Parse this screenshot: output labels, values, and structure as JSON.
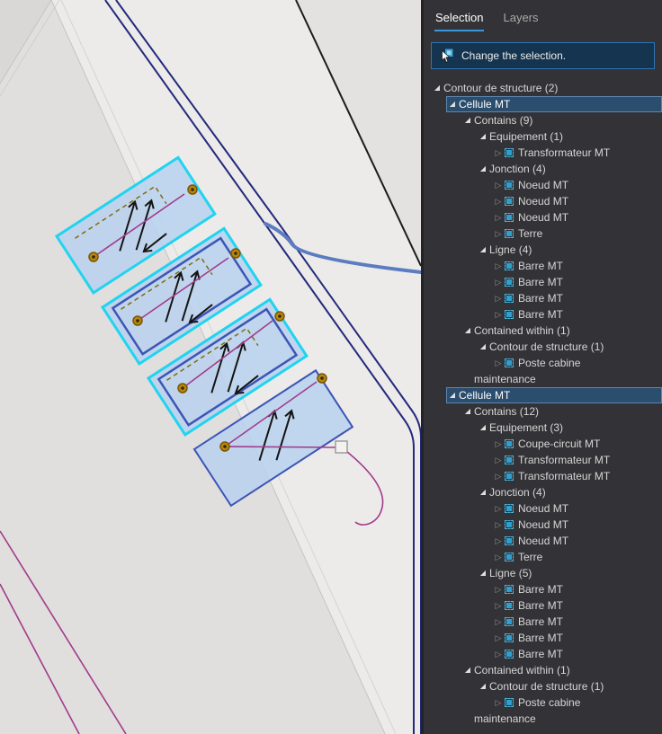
{
  "colors": {
    "accent_blue": "#3a96dd",
    "selection_cyan": "#22d3f0",
    "cell_fill": "#b9d2ee",
    "cell_border": "#3d55b5",
    "node_orange": "#b8860b",
    "line_magenta": "#a23a8c",
    "line_navy": "#232a7c",
    "line_steel": "#5b7cc0",
    "dashed_olive": "#7d6d10",
    "panel_bg": "#333337",
    "selected_row_bg": "#2b4d6e",
    "action_bar_bg": "#14344f",
    "action_bar_border": "#2e75b5"
  },
  "panel": {
    "tabs": [
      {
        "label": "Selection",
        "active": true
      },
      {
        "label": "Layers",
        "active": false
      }
    ],
    "action_bar": {
      "label": "Change the selection."
    },
    "tree": [
      {
        "label": "Contour de structure (2)",
        "level": 0,
        "glyph": "expanded"
      },
      {
        "label": "Cellule MT",
        "level": 1,
        "glyph": "expanded",
        "selected": true
      },
      {
        "label": "Contains (9)",
        "level": 2,
        "glyph": "expanded"
      },
      {
        "label": "Equipement (1)",
        "level": 3,
        "glyph": "expanded"
      },
      {
        "label": "Transformateur MT",
        "level": 4,
        "glyph": "collapsed",
        "icon": true
      },
      {
        "label": "Jonction (4)",
        "level": 3,
        "glyph": "expanded"
      },
      {
        "label": "Noeud MT",
        "level": 4,
        "glyph": "collapsed",
        "icon": true
      },
      {
        "label": "Noeud MT",
        "level": 4,
        "glyph": "collapsed",
        "icon": true
      },
      {
        "label": "Noeud MT",
        "level": 4,
        "glyph": "collapsed",
        "icon": true
      },
      {
        "label": "Terre",
        "level": 4,
        "glyph": "collapsed",
        "icon": true
      },
      {
        "label": "Ligne (4)",
        "level": 3,
        "glyph": "expanded"
      },
      {
        "label": "Barre MT",
        "level": 4,
        "glyph": "collapsed",
        "icon": true
      },
      {
        "label": "Barre MT",
        "level": 4,
        "glyph": "collapsed",
        "icon": true
      },
      {
        "label": "Barre MT",
        "level": 4,
        "glyph": "collapsed",
        "icon": true
      },
      {
        "label": "Barre MT",
        "level": 4,
        "glyph": "collapsed",
        "icon": true
      },
      {
        "label": "Contained within (1)",
        "level": 2,
        "glyph": "expanded"
      },
      {
        "label": "Contour de structure (1)",
        "level": 3,
        "glyph": "expanded"
      },
      {
        "label": "Poste cabine",
        "level": 4,
        "glyph": "collapsed",
        "icon": true
      },
      {
        "label": "maintenance",
        "level": 2,
        "glyph": "none"
      },
      {
        "label": "Cellule MT",
        "level": 1,
        "glyph": "expanded",
        "selected": true
      },
      {
        "label": "Contains (12)",
        "level": 2,
        "glyph": "expanded"
      },
      {
        "label": "Equipement (3)",
        "level": 3,
        "glyph": "expanded"
      },
      {
        "label": "Coupe-circuit MT",
        "level": 4,
        "glyph": "collapsed",
        "icon": true
      },
      {
        "label": "Transformateur MT",
        "level": 4,
        "glyph": "collapsed",
        "icon": true
      },
      {
        "label": "Transformateur MT",
        "level": 4,
        "glyph": "collapsed",
        "icon": true
      },
      {
        "label": "Jonction (4)",
        "level": 3,
        "glyph": "expanded"
      },
      {
        "label": "Noeud MT",
        "level": 4,
        "glyph": "collapsed",
        "icon": true
      },
      {
        "label": "Noeud MT",
        "level": 4,
        "glyph": "collapsed",
        "icon": true
      },
      {
        "label": "Noeud MT",
        "level": 4,
        "glyph": "collapsed",
        "icon": true
      },
      {
        "label": "Terre",
        "level": 4,
        "glyph": "collapsed",
        "icon": true
      },
      {
        "label": "Ligne (5)",
        "level": 3,
        "glyph": "expanded"
      },
      {
        "label": "Barre MT",
        "level": 4,
        "glyph": "collapsed",
        "icon": true
      },
      {
        "label": "Barre MT",
        "level": 4,
        "glyph": "collapsed",
        "icon": true
      },
      {
        "label": "Barre MT",
        "level": 4,
        "glyph": "collapsed",
        "icon": true
      },
      {
        "label": "Barre MT",
        "level": 4,
        "glyph": "collapsed",
        "icon": true
      },
      {
        "label": "Barre MT",
        "level": 4,
        "glyph": "collapsed",
        "icon": true
      },
      {
        "label": "Contained within (1)",
        "level": 2,
        "glyph": "expanded"
      },
      {
        "label": "Contour de structure (1)",
        "level": 3,
        "glyph": "expanded"
      },
      {
        "label": "Poste cabine",
        "level": 4,
        "glyph": "collapsed",
        "icon": true
      },
      {
        "label": "maintenance",
        "level": 2,
        "glyph": "none"
      }
    ]
  }
}
